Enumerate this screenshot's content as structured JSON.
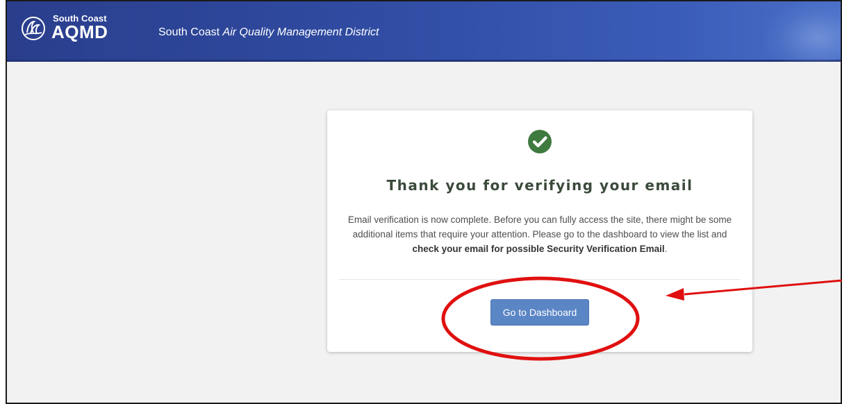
{
  "header": {
    "logo_small": "South Coast",
    "logo_big": "AQMD",
    "logo_icon": "aqmd-swirl-icon",
    "title_plain": "South Coast",
    "title_italic": "Air Quality Management District",
    "background_color": "#2f4aa0"
  },
  "card": {
    "status_icon": "check-circle-icon",
    "status_color": "#3f7a3f",
    "title": "Thank you for verifying your email",
    "message_part1": "Email verification is now complete. Before you can fully access the site, there might be some additional items that require your attention. Please go to the dashboard to view the list and",
    "message_bold": "check your email for possible Security Verification Email",
    "message_end": ".",
    "button_label": "Go to Dashboard",
    "button_color": "#5b86c5"
  },
  "annotation": {
    "type": "red-ellipse-and-arrow",
    "color": "#e01010"
  }
}
